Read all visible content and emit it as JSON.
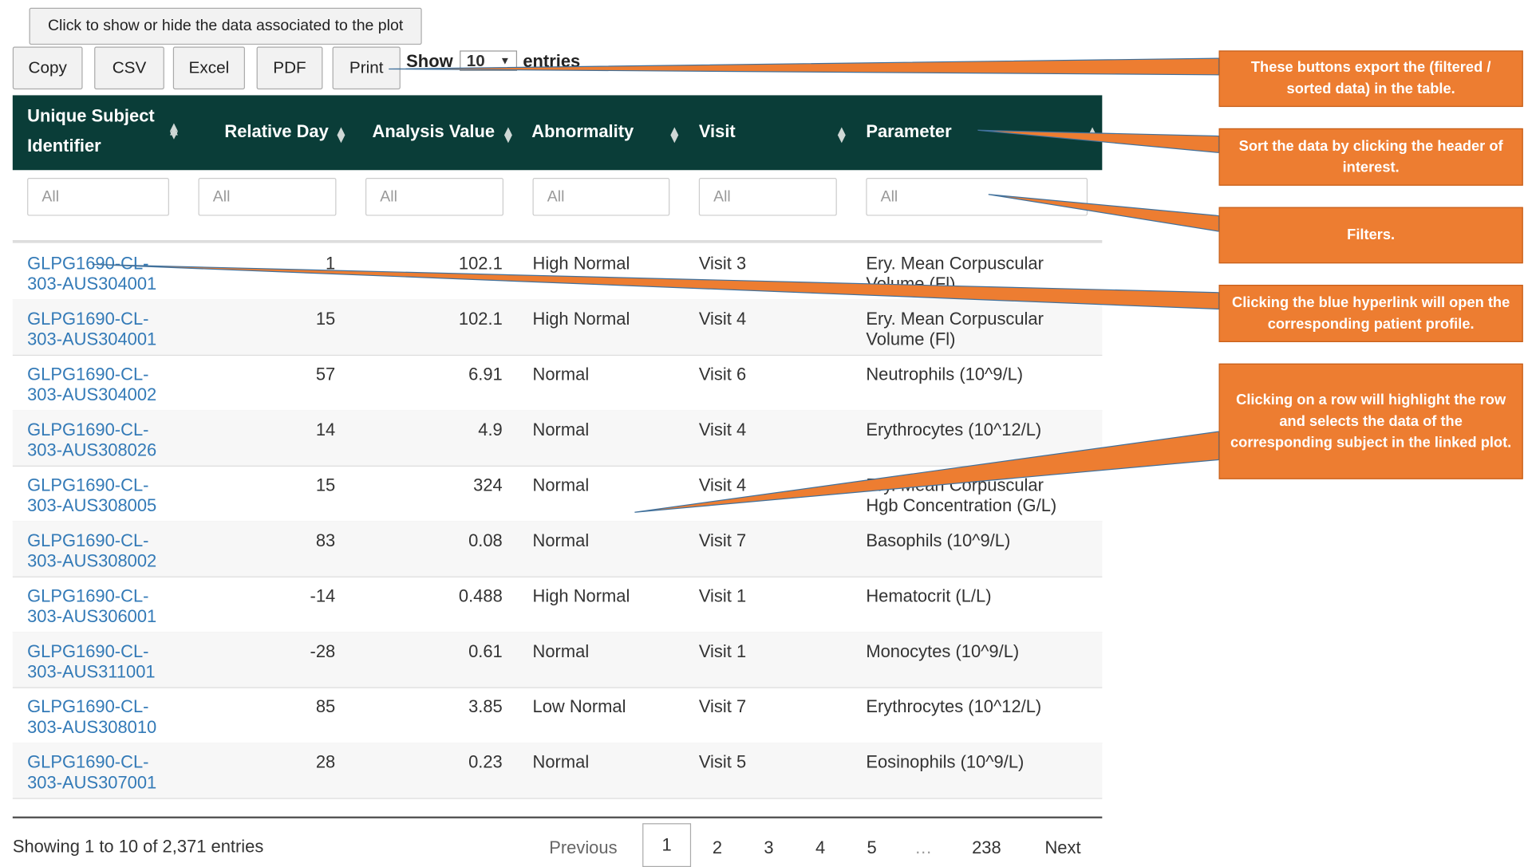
{
  "toolbar": {
    "toggle_label": "Click to show or hide the data associated to the plot",
    "copy_label": "Copy",
    "csv_label": "CSV",
    "excel_label": "Excel",
    "pdf_label": "PDF",
    "print_label": "Print",
    "show_label": "Show",
    "entries_value": "10",
    "entries_label": "entries"
  },
  "table": {
    "columns": [
      "Unique Subject Identifier",
      "Relative Day",
      "Analysis Value",
      "Abnormality",
      "Visit",
      "Parameter"
    ],
    "header_id_line1": "Unique Subject",
    "header_id_line2": "Identifier",
    "filter_placeholder": "All",
    "rows": [
      {
        "id1": "GLPG1690-CL-",
        "id2": "303-AUS304001",
        "day": "1",
        "value": "102.1",
        "abnormality": "High Normal",
        "visit": "Visit 3",
        "param1": "Ery. Mean Corpuscular",
        "param2": "Volume (Fl)"
      },
      {
        "id1": "GLPG1690-CL-",
        "id2": "303-AUS304001",
        "day": "15",
        "value": "102.1",
        "abnormality": "High Normal",
        "visit": "Visit 4",
        "param1": "Ery. Mean Corpuscular",
        "param2": "Volume (Fl)"
      },
      {
        "id1": "GLPG1690-CL-",
        "id2": "303-AUS304002",
        "day": "57",
        "value": "6.91",
        "abnormality": "Normal",
        "visit": "Visit 6",
        "param1": "Neutrophils (10^9/L)",
        "param2": ""
      },
      {
        "id1": "GLPG1690-CL-",
        "id2": "303-AUS308026",
        "day": "14",
        "value": "4.9",
        "abnormality": "Normal",
        "visit": "Visit 4",
        "param1": "Erythrocytes (10^12/L)",
        "param2": ""
      },
      {
        "id1": "GLPG1690-CL-",
        "id2": "303-AUS308005",
        "day": "15",
        "value": "324",
        "abnormality": "Normal",
        "visit": "Visit 4",
        "param1": "Ery. Mean Corpuscular",
        "param2": "Hgb Concentration (G/L)"
      },
      {
        "id1": "GLPG1690-CL-",
        "id2": "303-AUS308002",
        "day": "83",
        "value": "0.08",
        "abnormality": "Normal",
        "visit": "Visit 7",
        "param1": "Basophils (10^9/L)",
        "param2": ""
      },
      {
        "id1": "GLPG1690-CL-",
        "id2": "303-AUS306001",
        "day": "-14",
        "value": "0.488",
        "abnormality": "High Normal",
        "visit": "Visit 1",
        "param1": "Hematocrit (L/L)",
        "param2": ""
      },
      {
        "id1": "GLPG1690-CL-",
        "id2": "303-AUS311001",
        "day": "-28",
        "value": "0.61",
        "abnormality": "Normal",
        "visit": "Visit 1",
        "param1": "Monocytes (10^9/L)",
        "param2": ""
      },
      {
        "id1": "GLPG1690-CL-",
        "id2": "303-AUS308010",
        "day": "85",
        "value": "3.85",
        "abnormality": "Low Normal",
        "visit": "Visit 7",
        "param1": "Erythrocytes (10^12/L)",
        "param2": ""
      },
      {
        "id1": "GLPG1690-CL-",
        "id2": "303-AUS307001",
        "day": "28",
        "value": "0.23",
        "abnormality": "Normal",
        "visit": "Visit 5",
        "param1": "Eosinophils (10^9/L)",
        "param2": ""
      }
    ]
  },
  "footer": {
    "info": "Showing 1 to 10 of 2,371 entries",
    "previous": "Previous",
    "pages": [
      "1",
      "2",
      "3",
      "4",
      "5",
      "…",
      "238"
    ],
    "next": "Next"
  },
  "callouts": {
    "export": "These buttons export the (filtered / sorted data) in the table.",
    "sort": "Sort the data by clicking the header of interest.",
    "filters": "Filters.",
    "hyperlink": "Clicking the blue hyperlink will open the corresponding patient profile.",
    "row": "Clicking on a row will highlight the row and selects the data of the corresponding subject in the linked plot."
  },
  "colors": {
    "header_bg": "#0a3d38",
    "link": "#337ab7",
    "callout": "#ed7d31"
  }
}
